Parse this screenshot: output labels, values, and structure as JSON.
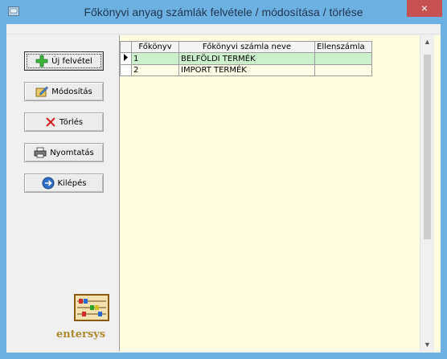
{
  "window": {
    "title": "Főkönyvi anyag számlák felvétele / módosítása / törlése",
    "close_symbol": "×"
  },
  "buttons": {
    "new": "Új felvétel",
    "modify": "Módosítás",
    "delete": "Törlés",
    "print": "Nyomtatás",
    "exit": "Kilépés"
  },
  "branding": {
    "name": "entersys"
  },
  "grid": {
    "columns": [
      "Főkönyv",
      "Főkönyvi számla neve",
      "Ellenszámla"
    ],
    "rows": [
      {
        "fokonyv": "1",
        "nev": "BELFÖLDI TERMÉK",
        "ellenszamla": ""
      },
      {
        "fokonyv": "2",
        "nev": "IMPORT TERMÉK",
        "ellenszamla": ""
      }
    ]
  },
  "colors": {
    "selected_row": "#cbf0cb",
    "grid_background": "#fffde0",
    "title_bar": "#6db1e2",
    "close_button": "#c75050"
  }
}
